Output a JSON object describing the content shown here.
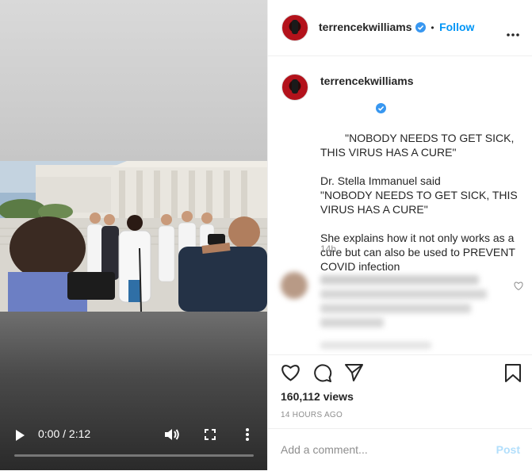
{
  "post": {
    "username": "terrencekwilliams",
    "follow_label": "Follow",
    "separator": "•",
    "caption": {
      "headline": "\"NOBODY NEEDS TO GET SICK, THIS VIRUS HAS A CURE\"",
      "para2": "Dr. Stella Immanuel said\n\"NOBODY NEEDS TO GET SICK, THIS VIRUS HAS A CURE\"",
      "para3": "She explains how it not only works as a cure but can also be used to PREVENT COVID infection"
    },
    "posted_ago": "14h",
    "views": "160,112 views",
    "timestamp": "14 HOURS AGO"
  },
  "video": {
    "time": "0:00 / 2:12",
    "progress": 0.0
  },
  "comment_box": {
    "placeholder": "Add a comment...",
    "post_label": "Post"
  },
  "colors": {
    "accent": "#0095f6",
    "post_disabled": "#b2dffc",
    "muted": "#8e8e8e",
    "verified": "#3897f0"
  },
  "icons": [
    "play-icon",
    "volume-icon",
    "fullscreen-icon",
    "video-more-icon",
    "more-options-icon",
    "verified-icon",
    "heart-icon",
    "comment-icon",
    "share-icon",
    "bookmark-icon"
  ]
}
